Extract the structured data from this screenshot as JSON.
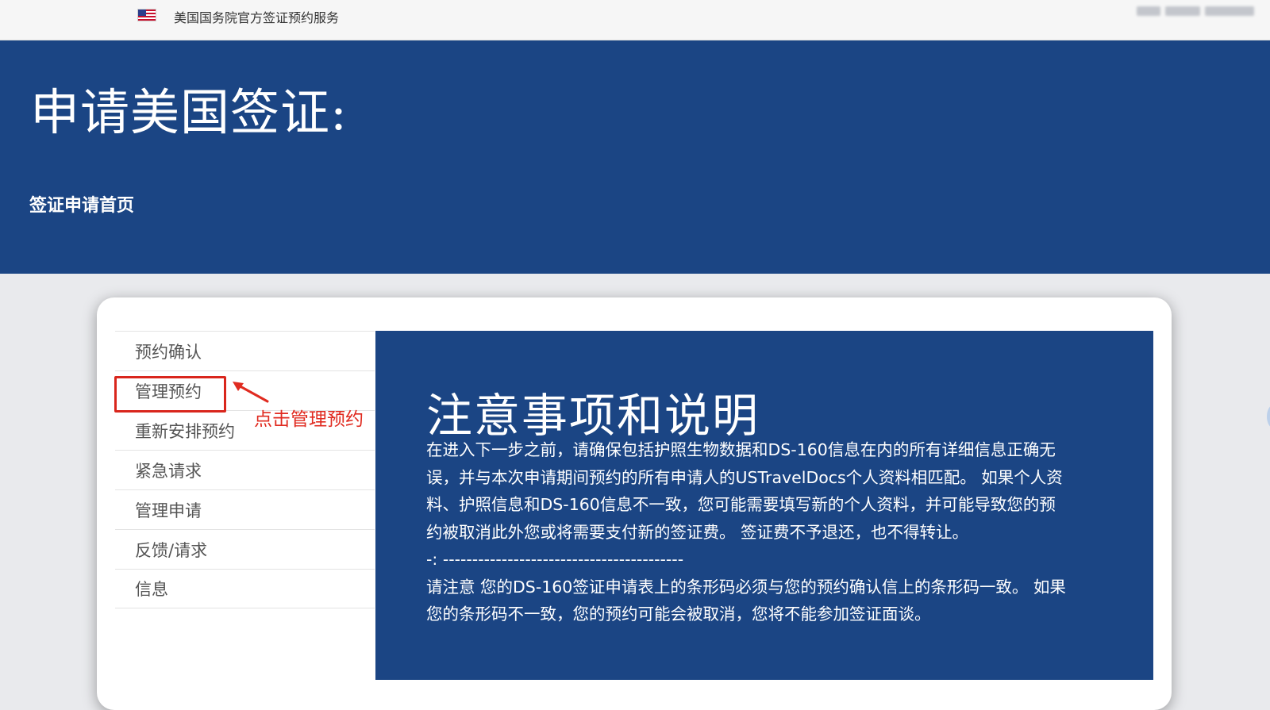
{
  "topbar": {
    "flag_icon": "us-flag-icon",
    "site_name": "美国国务院官方签证预约服务"
  },
  "hero": {
    "title": "申请美国签证:",
    "breadcrumb": "签证申请首页"
  },
  "sidebar": {
    "items": [
      {
        "label": "预约确认"
      },
      {
        "label": "管理预约"
      },
      {
        "label": "重新安排预约"
      },
      {
        "label": "紧急请求"
      },
      {
        "label": "管理申请"
      },
      {
        "label": "反馈/请求"
      },
      {
        "label": "信息"
      }
    ]
  },
  "annotation": {
    "text": "点击管理预约",
    "color": "#e02b20"
  },
  "notice": {
    "title": "注意事项和说明",
    "paragraph1": "在进入下一步之前，请确保包括护照生物数据和DS-160信息在内的所有详细信息正确无误，并与本次申请期间预约的所有申请人的USTravelDocs个人资料相匹配。 如果个人资料、护照信息和DS-160信息不一致，您可能需要填写新的个人资料，并可能导致您的预约被取消此外您或将需要支付新的签证费。 签证费不予退还，也不得转让。",
    "separator": "-: -----------------------------------------",
    "paragraph2": "请注意 您的DS-160签证申请表上的条形码必须与您的预约确认信上的条形码一致。 如果您的条形码不一致，您的预约可能会被取消，您将不能参加签证面谈。"
  },
  "colors": {
    "brand_blue": "#1b4584",
    "highlight_red": "#d9261c"
  }
}
